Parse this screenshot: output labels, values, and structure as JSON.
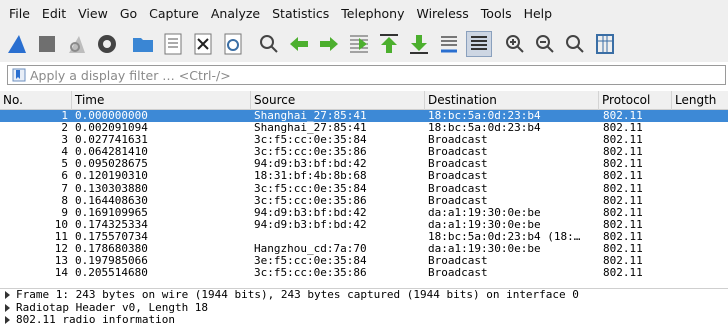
{
  "menu": [
    "File",
    "Edit",
    "View",
    "Go",
    "Capture",
    "Analyze",
    "Statistics",
    "Telephony",
    "Wireless",
    "Tools",
    "Help"
  ],
  "toolbar": {
    "icons": [
      "shark-fin-start-icon",
      "stop-square-icon",
      "shark-fin-restart-icon",
      "gear-options-icon",
      "open-folder-icon",
      "save-file-icon",
      "close-file-icon",
      "reload-icon",
      "search-icon",
      "back-arrow-icon",
      "forward-arrow-icon",
      "goto-packet-icon",
      "first-packet-icon",
      "last-packet-icon",
      "autoscroll-icon",
      "colorize-icon",
      "zoom-in-icon",
      "zoom-out-icon",
      "zoom-reset-icon",
      "resize-columns-icon"
    ]
  },
  "filter": {
    "placeholder": "Apply a display filter … <Ctrl-/>",
    "value": ""
  },
  "columns": {
    "no": "No.",
    "time": "Time",
    "source": "Source",
    "destination": "Destination",
    "protocol": "Protocol",
    "length": "Length"
  },
  "packets": [
    {
      "no": "1",
      "time": "0.000000000",
      "source": "Shanghai_27:85:41",
      "destination": "18:bc:5a:0d:23:b4",
      "protocol": "802.11",
      "length": ""
    },
    {
      "no": "2",
      "time": "0.002091094",
      "source": "Shanghai_27:85:41",
      "destination": "18:bc:5a:0d:23:b4",
      "protocol": "802.11",
      "length": ""
    },
    {
      "no": "3",
      "time": "0.027741631",
      "source": "3c:f5:cc:0e:35:84",
      "destination": "Broadcast",
      "protocol": "802.11",
      "length": ""
    },
    {
      "no": "4",
      "time": "0.064281410",
      "source": "3c:f5:cc:0e:35:86",
      "destination": "Broadcast",
      "protocol": "802.11",
      "length": ""
    },
    {
      "no": "5",
      "time": "0.095028675",
      "source": "94:d9:b3:bf:bd:42",
      "destination": "Broadcast",
      "protocol": "802.11",
      "length": ""
    },
    {
      "no": "6",
      "time": "0.120190310",
      "source": "18:31:bf:4b:8b:68",
      "destination": "Broadcast",
      "protocol": "802.11",
      "length": ""
    },
    {
      "no": "7",
      "time": "0.130303880",
      "source": "3c:f5:cc:0e:35:84",
      "destination": "Broadcast",
      "protocol": "802.11",
      "length": ""
    },
    {
      "no": "8",
      "time": "0.164408630",
      "source": "3c:f5:cc:0e:35:86",
      "destination": "Broadcast",
      "protocol": "802.11",
      "length": ""
    },
    {
      "no": "9",
      "time": "0.169109965",
      "source": "94:d9:b3:bf:bd:42",
      "destination": "da:a1:19:30:0e:be",
      "protocol": "802.11",
      "length": ""
    },
    {
      "no": "10",
      "time": "0.174325334",
      "source": "94:d9:b3:bf:bd:42",
      "destination": "da:a1:19:30:0e:be",
      "protocol": "802.11",
      "length": ""
    },
    {
      "no": "11",
      "time": "0.175570734",
      "source": "",
      "destination": "18:bc:5a:0d:23:b4 (18:…",
      "protocol": "802.11",
      "length": ""
    },
    {
      "no": "12",
      "time": "0.178680380",
      "source": "Hangzhou_cd:7a:70",
      "destination": "da:a1:19:30:0e:be",
      "protocol": "802.11",
      "length": ""
    },
    {
      "no": "13",
      "time": "0.197985066",
      "source": "3e:f5:cc:0e:35:84",
      "destination": "Broadcast",
      "protocol": "802.11",
      "length": ""
    },
    {
      "no": "14",
      "time": "0.205514680",
      "source": "3c:f5:cc:0e:35:86",
      "destination": "Broadcast",
      "protocol": "802.11",
      "length": ""
    }
  ],
  "details": [
    "Frame 1: 243 bytes on wire (1944 bits), 243 bytes captured (1944 bits) on interface 0",
    "Radiotap Header v0, Length 18",
    "802.11 radio information"
  ],
  "colors": {
    "selection": "#3d89d6",
    "chrome": "#efefef"
  }
}
